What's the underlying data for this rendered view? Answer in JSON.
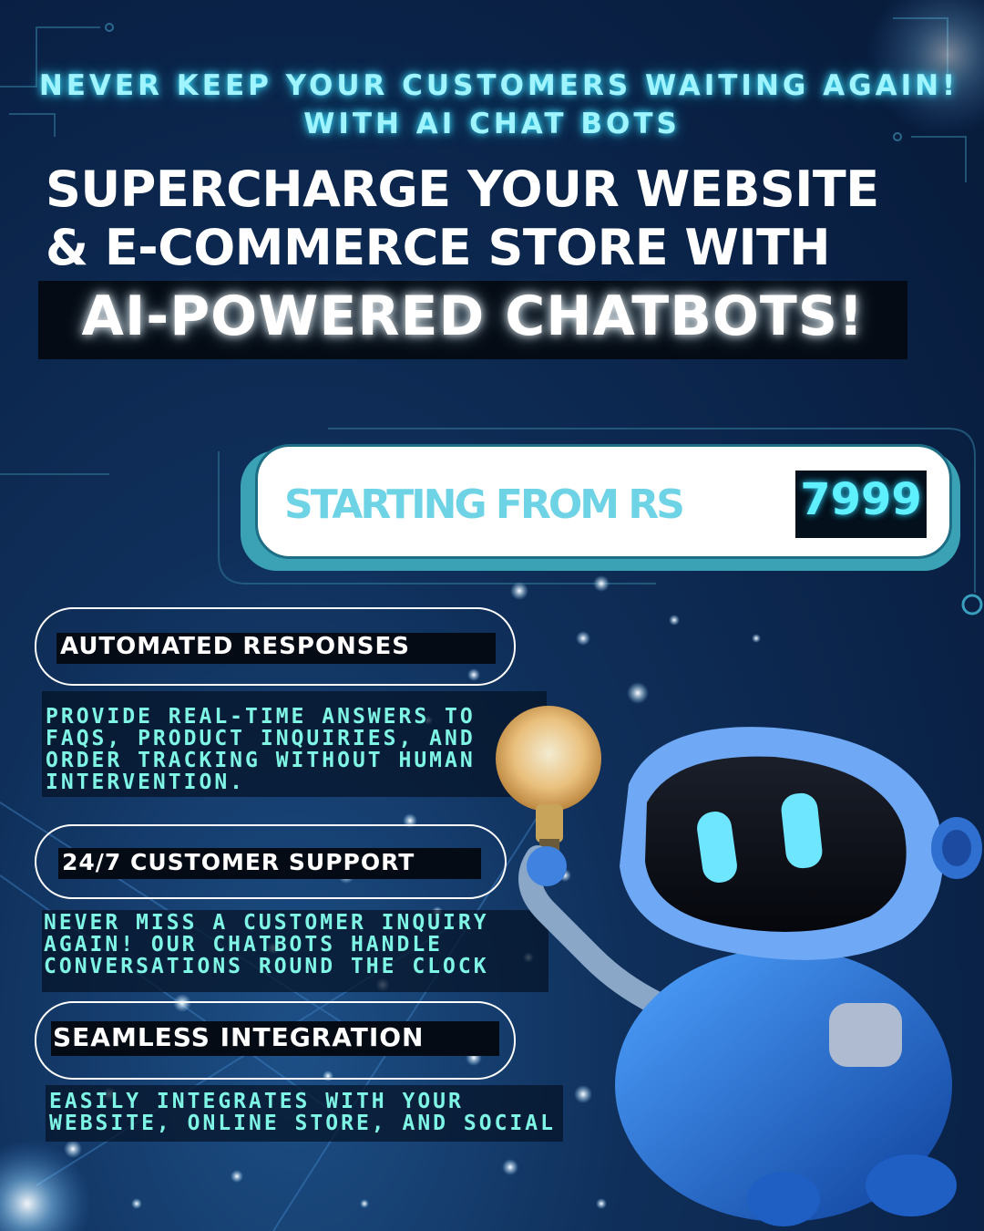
{
  "tagline": {
    "line1": "NEVER KEEP YOUR CUSTOMERS WAITING AGAIN!",
    "line2": "WITH AI CHAT BOTS"
  },
  "headline": {
    "line1": "SUPERCHARGE YOUR WEBSITE",
    "line2": "& E-COMMERCE STORE WITH",
    "highlight": "AI-POWERED CHATBOTS!"
  },
  "price": {
    "label": "STARTING FROM RS",
    "value": "7999"
  },
  "features": [
    {
      "title": "AUTOMATED RESPONSES",
      "description": "PROVIDE REAL-TIME ANSWERS TO\nFAQS, PRODUCT INQUIRIES, AND\nORDER TRACKING WITHOUT HUMAN\nINTERVENTION."
    },
    {
      "title": "24/7 CUSTOMER SUPPORT",
      "description": "NEVER MISS A CUSTOMER INQUIRY\nAGAIN! OUR CHATBOTS HANDLE\nCONVERSATIONS ROUND THE CLOCK"
    },
    {
      "title": "SEAMLESS INTEGRATION",
      "description": "EASILY INTEGRATES WITH YOUR\nWEBSITE, ONLINE STORE, AND SOCIAL"
    }
  ],
  "colors": {
    "background": "#0a2247",
    "accent_cyan": "#9ff4ff",
    "description_teal": "#7ff5e6",
    "robot_blue": "#1f6fd6"
  },
  "illustration": {
    "robot": "robot-icon",
    "bulb": "lightbulb-icon"
  }
}
